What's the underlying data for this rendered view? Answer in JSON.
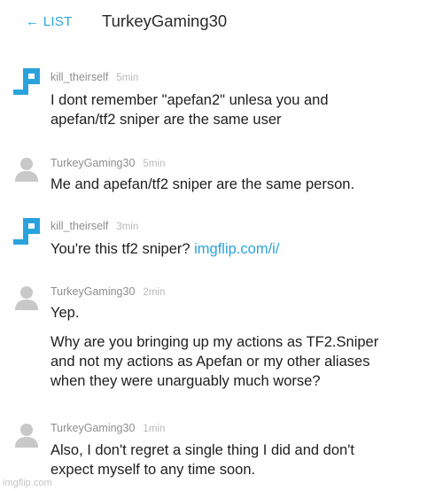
{
  "header": {
    "back_label": "← LIST",
    "title": "TurkeyGaming30"
  },
  "messages": [
    {
      "user": "kill_theirself",
      "time": "5min",
      "lines": [
        "I dont remember \"apefan2\" unlesa you and",
        "apefan/tf2 sniper are the same user"
      ]
    },
    {
      "user": "TurkeyGaming30",
      "time": "5min",
      "lines": [
        "Me and apefan/tf2 sniper are the same person."
      ]
    },
    {
      "user": "kill_theirself",
      "time": "3min",
      "text": "You're this tf2 sniper? ",
      "link": "imgflip.com/i/"
    },
    {
      "user": "TurkeyGaming30",
      "time": "2min",
      "lines": [
        "Yep."
      ],
      "paragraph2": [
        "Why are you bringing up my actions as TF2.Sniper",
        "and not my actions as Apefan or my other aliases",
        "when they were unarguably much worse?"
      ]
    },
    {
      "user": "TurkeyGaming30",
      "time": "1min",
      "lines": [
        "Also, I don't regret a single thing I did and don't",
        "expect myself to any time soon."
      ]
    }
  ],
  "watermark": "imgflip.com",
  "colors": {
    "accent": "#2aa3dd",
    "avatar_grey": "#c8c8c8"
  },
  "icons": {
    "user_avatar_kill": "imgflip-logo-avatar",
    "user_avatar_turkey": "default-person-avatar"
  }
}
